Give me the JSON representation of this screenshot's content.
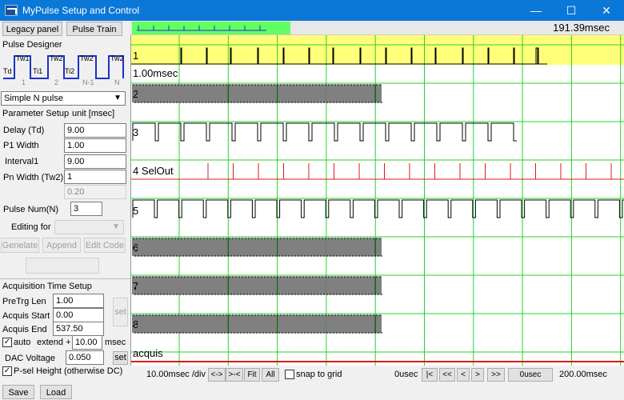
{
  "window": {
    "title": "MyPulse Setup and Control",
    "minimize": "—",
    "maximize": "☐",
    "close": "✕"
  },
  "left": {
    "legacy_button": "Legacy panel",
    "pulse_train_button": "Pulse Train",
    "designer_title": "Pulse Designer",
    "diagram": {
      "td": "Td",
      "tw1": "Tw1",
      "ti1": "Ti1",
      "tw2": "Tw2",
      "ti2": "Ti2",
      "tw2b": "Tw2",
      "tw2c": "Tw2",
      "n1": "1",
      "n2": "2",
      "nm1": "N-1",
      "nn": "N"
    },
    "mode_select": "Simple N pulse",
    "param_title": "Parameter Setup",
    "unit_label": "unit [msec]",
    "delay_label": "Delay (Td)",
    "delay_value": "9.00",
    "p1_label": "P1 Width",
    "p1_value": "1.00",
    "interval_label": "Interval1",
    "interval_value": "9.00",
    "pn_label": "Pn Width (Tw2)",
    "pn_value": "1",
    "extra_value": "0.20",
    "pulse_num_label": "Pulse Num(N)",
    "pulse_num_value": "3",
    "editing_label": "Editing for",
    "genelate_button": "Genelate",
    "append_button": "Append",
    "edit_code_button": "Edit Code",
    "acq_title": "Acquisition Time Setup",
    "pretrg_label": "PreTrg Len",
    "pretrg_value": "1.00",
    "acq_start_label": "Acquis Start",
    "acq_start_value": "0.00",
    "acq_end_label": "Acquis End",
    "acq_end_value": "537.50",
    "set_button": "set",
    "auto_label": "auto",
    "extend_label": "extend +",
    "extend_value": "10.00",
    "msec_label": "msec",
    "dac_label": "DAC Voltage",
    "dac_value": "0.050",
    "dac_set": "set",
    "psel_label": "P-sel Height (otherwise DC)",
    "save_button": "Save",
    "load_button": "Load"
  },
  "top": {
    "time_readout": "191.39msec"
  },
  "plot": {
    "channels": [
      "1",
      "1.00msec",
      "2",
      "3",
      "4  SelOut",
      "5",
      "6",
      "7",
      "8",
      "acquis"
    ],
    "colors": {
      "grid": "#28d028",
      "trace": "#000000",
      "selout": "#e01818",
      "highlight": "#ffff7a"
    }
  },
  "bottom": {
    "div_label": "10.00msec  /div",
    "zoom_in": "<->",
    "zoom_out": ">-<",
    "fit": "Fit",
    "all": "All",
    "snap_label": "snap to grid",
    "start_time": "0usec",
    "first": "|<",
    "prev_page": "<<",
    "prev": "<",
    "next": ">",
    "next_page": ">>",
    "cursor_value": "0usec",
    "end_time": "200.00msec"
  }
}
